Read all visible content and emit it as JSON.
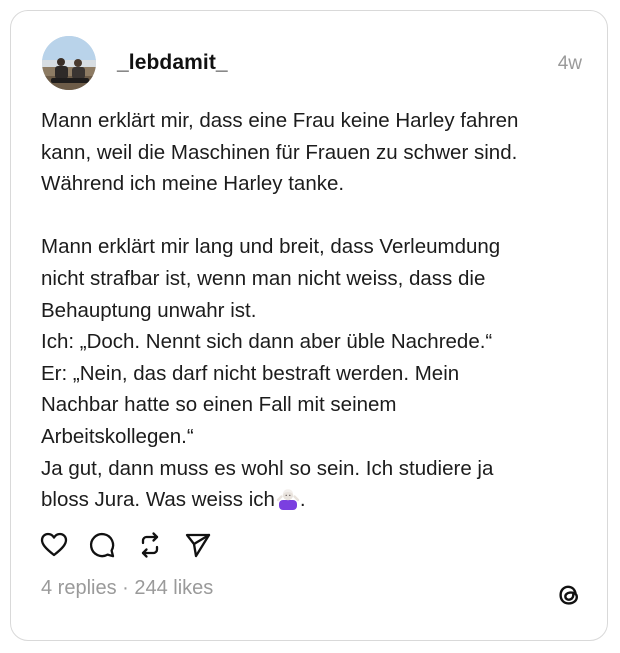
{
  "post": {
    "username": "_lebdamit_",
    "timestamp": "4w",
    "paragraph1": [
      "Mann erklärt mir, dass eine Frau keine Harley fahren",
      "kann, weil die Maschinen für Frauen zu schwer sind.",
      "Während ich meine Harley tanke."
    ],
    "paragraph2": [
      "Mann erklärt mir lang und breit, dass Verleumdung",
      "nicht strafbar ist, wenn man nicht weiss, dass die",
      "Behauptung unwahr ist.",
      "Ich: „Doch. Nennt sich dann aber üble Nachrede.“",
      "Er: „Nein, das darf nicht bestraft werden. Mein",
      "Nachbar hatte so einen Fall mit seinem",
      "Arbeitskollegen.“",
      "Ja gut, dann muss es wohl so sein. Ich studiere ja"
    ],
    "last_line_text": "bloss Jura. Was weiss ich",
    "last_line_end": ".",
    "emoji": "person-shrugging-emoji",
    "stats": "4 replies · 244 likes"
  },
  "actions": {
    "like_icon": "heart-icon",
    "reply_icon": "comment-icon",
    "repost_icon": "repost-icon",
    "share_icon": "send-icon"
  },
  "brand": {
    "logo_icon": "threads-logo-icon"
  },
  "colors": {
    "text": "#1c1c1c",
    "muted": "#9a9a9a",
    "border": "#d9d9d9",
    "emoji_shirt": "#7b3fe0"
  }
}
